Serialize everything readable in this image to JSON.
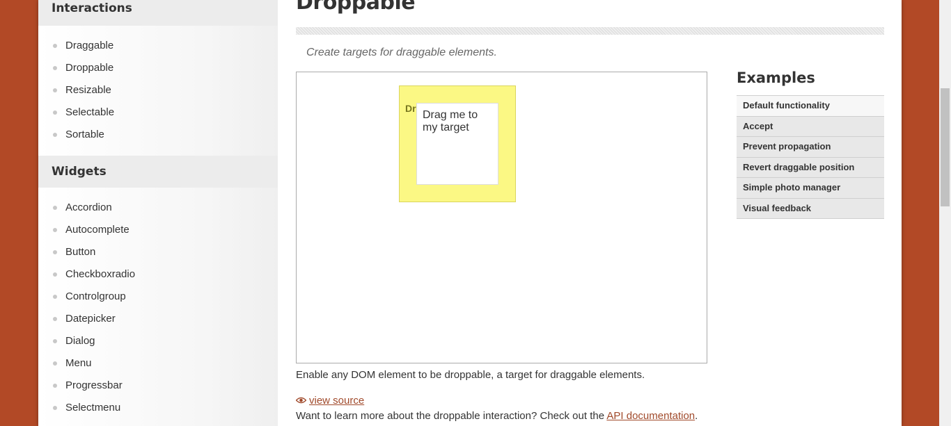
{
  "sidebar": {
    "interactions_heading": "Interactions",
    "interactions": [
      "Draggable",
      "Droppable",
      "Resizable",
      "Selectable",
      "Sortable"
    ],
    "widgets_heading": "Widgets",
    "widgets": [
      "Accordion",
      "Autocomplete",
      "Button",
      "Checkboxradio",
      "Controlgroup",
      "Datepicker",
      "Dialog",
      "Menu",
      "Progressbar",
      "Selectmenu"
    ]
  },
  "main": {
    "title": "Droppable",
    "subtitle": "Create targets for draggable elements.",
    "demo": {
      "droppable_label": "Drop here",
      "draggable_label": "Drag me to my target"
    },
    "description": "Enable any DOM element to be droppable, a target for draggable elements.",
    "view_source": "view source",
    "learn_more_prefix": "Want to learn more about the droppable interaction? Check out the ",
    "api_link": "API documentation",
    "learn_more_suffix": "."
  },
  "examples": {
    "heading": "Examples",
    "items": [
      "Default functionality",
      "Accept",
      "Prevent propagation",
      "Revert draggable position",
      "Simple photo manager",
      "Visual feedback"
    ]
  },
  "colors": {
    "background": "#b24926",
    "link": "#a0492a",
    "droppable_fill": "#fbf884"
  }
}
